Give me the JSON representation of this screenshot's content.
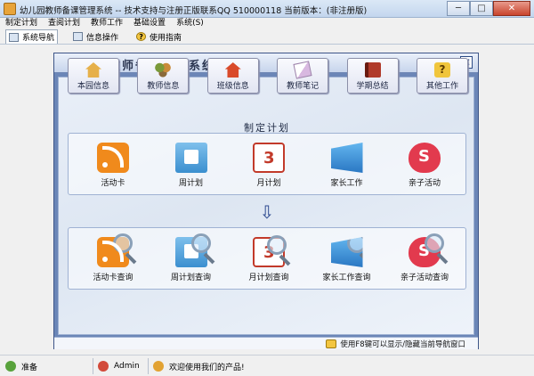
{
  "window": {
    "title": "幼儿园教师备课管理系统 -- 技术支持与注册正版联系QQ 510000118   当前版本：(非注册版)",
    "minimize": "─",
    "maximize": "□",
    "close": "✕"
  },
  "menubar": {
    "items": [
      "制定计划",
      "查阅计划",
      "教师工作",
      "基础设置",
      "系统(S)"
    ]
  },
  "toolbar": {
    "tabs": [
      "系统导航",
      "信息操作",
      "使用指南"
    ],
    "help_glyph": "?"
  },
  "panel": {
    "title": "幼儿园教师备课管理系统",
    "close": "✕",
    "info_buttons": [
      "本园信息",
      "教师信息",
      "班级信息",
      "教师笔记",
      "学期总结",
      "其他工作"
    ],
    "plan_section_title": "制定计划",
    "plan_items": [
      "活动卡",
      "周计划",
      "月计划",
      "家长工作",
      "亲子活动"
    ],
    "arrow": "⇩",
    "query_items": [
      "活动卡查询",
      "周计划查询",
      "月计划查询",
      "家长工作查询",
      "亲子活动查询"
    ],
    "hint": "使用F8键可以显示/隐藏当前导航窗口"
  },
  "statusbar": {
    "ready": "准备",
    "user": "Admin",
    "welcome": "欢迎使用我们的产品!"
  },
  "colors": {
    "panel_border": "#6b86b7",
    "accent_orange": "#f08a1c",
    "accent_blue": "#3b8fcf"
  }
}
